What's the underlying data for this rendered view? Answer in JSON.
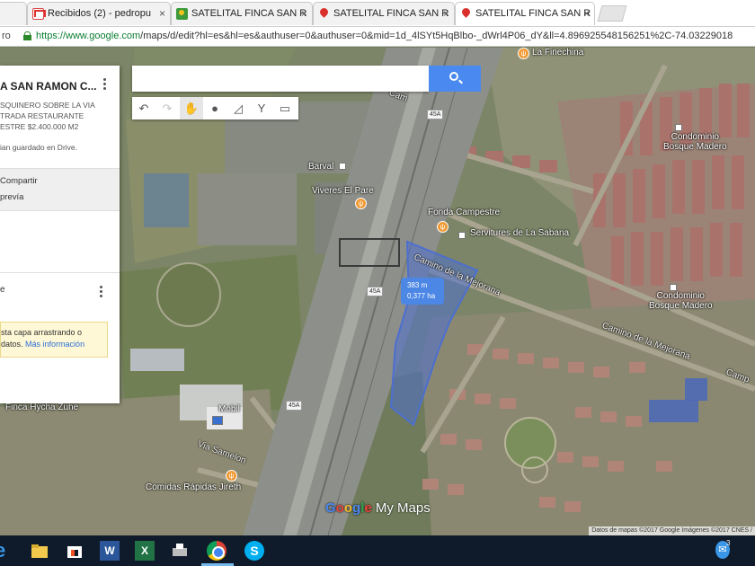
{
  "tabs": [
    {
      "icon": "gmail-icon",
      "label": "Recibidos (2) - pedropu",
      "close": "×"
    },
    {
      "icon": "google-maps-icon",
      "label": "SATELITAL FINCA SAN R",
      "close": "×"
    },
    {
      "icon": "map-pin-icon",
      "label": "SATELITAL FINCA SAN R",
      "close": "×"
    },
    {
      "icon": "map-pin-icon",
      "label": "SATELITAL FINCA SAN R",
      "close": "×"
    }
  ],
  "address_bar": {
    "lead": "ro",
    "url_host": "https://www.google.com",
    "url_rest": "/maps/d/edit?hl=es&hl=es&authuser=0&authuser=0&mid=1d_4lSYt5HqBlbo-_dWrl4P06_dY&ll=4.896925548156251%2C-74.03229018"
  },
  "panel": {
    "title": "A SAN RAMON C...",
    "description": [
      "SQUINERO SOBRE LA VIA",
      "TRADA RESTAURANTE",
      "ESTRE $2.400.000 M2"
    ],
    "drive_note": "ian guardado en Drive.",
    "share": "Compartir",
    "preview": "prevía",
    "layer_name": "e",
    "hint_line1": "sta capa arrastrando o",
    "hint_line2_prefix": "datos.",
    "hint_link": "Más información"
  },
  "toolbar": {
    "tools": [
      {
        "icon": "undo-icon",
        "glyph": "↶"
      },
      {
        "icon": "redo-icon",
        "glyph": "↷"
      },
      {
        "icon": "hand-icon",
        "glyph": "✋"
      },
      {
        "icon": "marker-icon",
        "glyph": "●"
      },
      {
        "icon": "draw-line-icon",
        "glyph": "◿"
      },
      {
        "icon": "directions-icon",
        "glyph": "Y"
      },
      {
        "icon": "ruler-icon",
        "glyph": "▭"
      }
    ]
  },
  "map": {
    "places": {
      "la_finechina": "La Finechina",
      "barval": "Barval",
      "viveres": "Viveres El Pare",
      "fonda": "Fonda Campestre",
      "servitures": "Servitures de La Sabana",
      "camino_mejorana_1": "Camino de la Mejorana",
      "camino_mejorana_2": "Camino de la Mejorana",
      "condominio_1_a": "Condominio",
      "condominio_1_b": "Bosque Madero",
      "condominio_2_a": "Condominio",
      "condominio_2_b": "Bosque Madero",
      "finca": "Finca Hycha Zuhe",
      "mobil": "Mobil",
      "via_samelon": "Via Samelon",
      "comidas": "Comidas Rápidas Jireth",
      "calle_left": "Cam",
      "calle_right": "Camp"
    },
    "shields": [
      "45A",
      "45A",
      "45A"
    ],
    "measurement": {
      "distance": "383 m",
      "area": "0,377 ha"
    },
    "logo_google": [
      "G",
      "o",
      "o",
      "g",
      "l",
      "e"
    ],
    "logo_suffix": "My Maps",
    "attribution": "Datos de mapas ©2017 Google Imágenes ©2017 CNES /"
  },
  "colors": {
    "accent_blue": "#4a89f0",
    "polygon_fill": "#4c6fd0",
    "poi_orange": "#f19a33"
  },
  "taskbar": {
    "word_letter": "W",
    "excel_letter": "X",
    "skype_letter": "S",
    "tray_badge": "3"
  }
}
